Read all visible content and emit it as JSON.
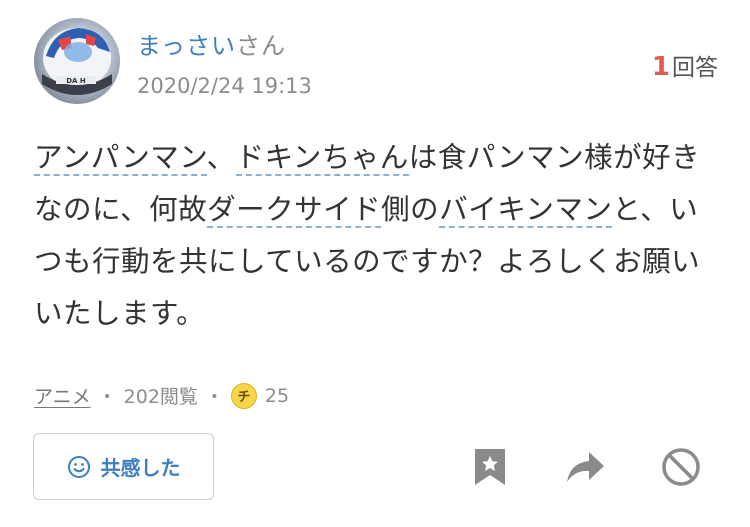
{
  "user": {
    "name": "まっさい",
    "suffix": "さん",
    "avatar_icon": "helmet-avatar"
  },
  "post": {
    "date": "2020/2/24 19:13",
    "answer_count": "1",
    "answer_label": "回答",
    "body": [
      {
        "text": "アンパンマン",
        "link": true
      },
      {
        "text": "、",
        "link": false
      },
      {
        "text": "ドキンちゃん",
        "link": true
      },
      {
        "text": "は食パンマン様が好きなのに、何故",
        "link": false
      },
      {
        "text": "ダークサイド",
        "link": true
      },
      {
        "text": "側の",
        "link": false
      },
      {
        "text": "バイキンマン",
        "link": true
      },
      {
        "text": "と、いつも行動を共にしているのですか？よろしくお願いいたします。",
        "link": false
      }
    ]
  },
  "meta": {
    "category": "アニメ",
    "views": "202閲覧",
    "coin_icon_label": "チ",
    "coins": "25",
    "separator": "・"
  },
  "actions": {
    "empathy_label": "共感した",
    "icons": [
      "smile-icon",
      "bookmark-star-icon",
      "share-arrow-icon",
      "block-icon"
    ]
  },
  "colors": {
    "accent_blue": "#3d7fc0",
    "answer_red": "#e05a5a",
    "muted_gray": "#8c8c8c",
    "coin_yellow": "#f7d64a"
  }
}
